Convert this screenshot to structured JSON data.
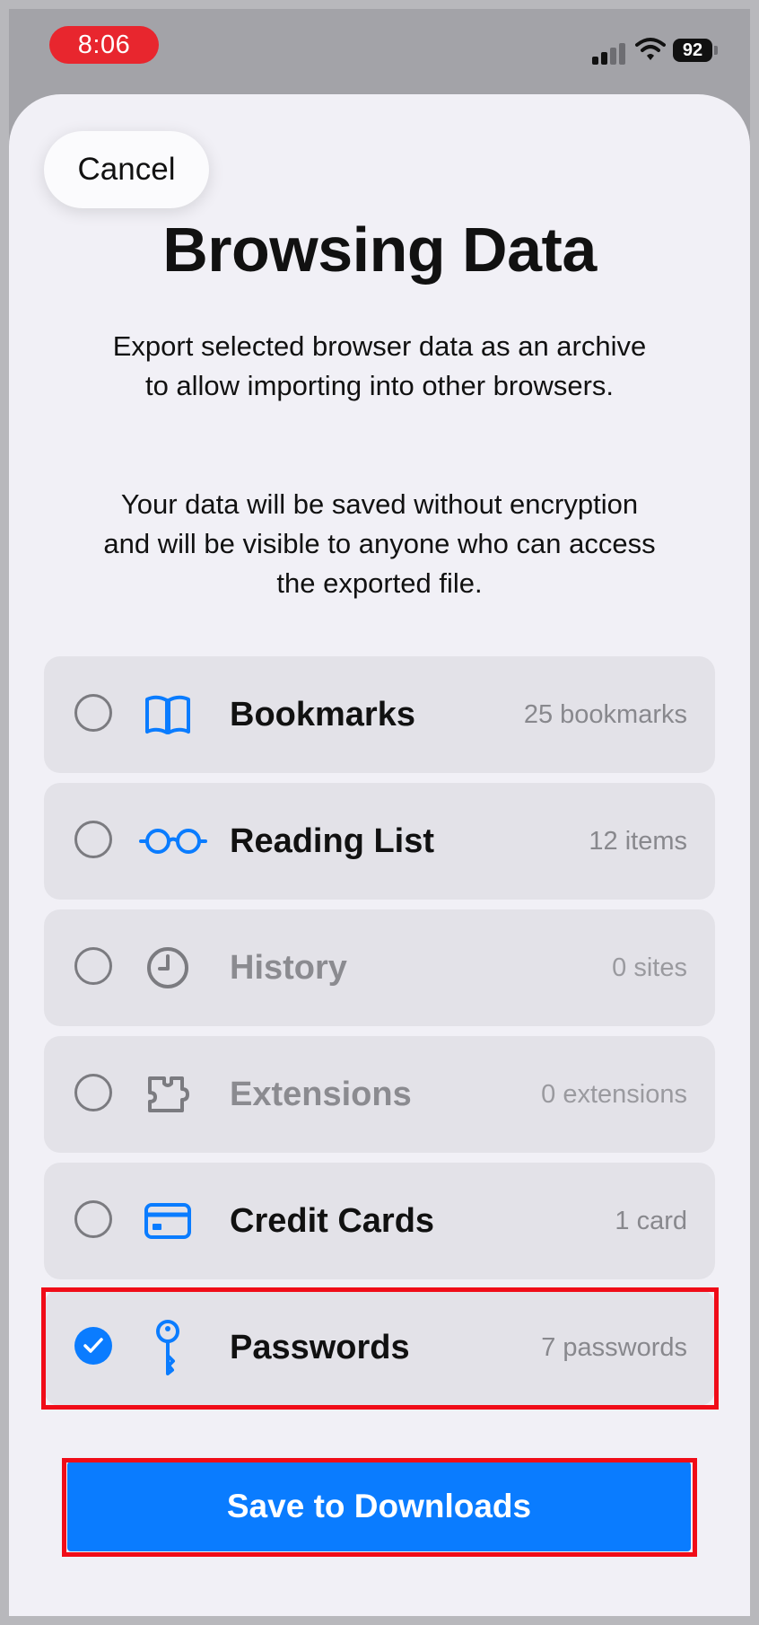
{
  "status_bar": {
    "time": "8:06",
    "battery": "92",
    "time_pill_color": "#e8262e"
  },
  "sheet": {
    "cancel_label": "Cancel",
    "title": "Browsing Data",
    "description_1": "Export selected browser data as an archive to allow importing into other browsers.",
    "description_2": "Your data will be saved without encryption and will be visible to anyone who can access the exported file."
  },
  "items": [
    {
      "label": "Bookmarks",
      "count": "25 bookmarks",
      "icon": "book-icon",
      "checked": false,
      "enabled": true
    },
    {
      "label": "Reading List",
      "count": "12 items",
      "icon": "glasses-icon",
      "checked": false,
      "enabled": true
    },
    {
      "label": "History",
      "count": "0 sites",
      "icon": "clock-icon",
      "checked": false,
      "enabled": false
    },
    {
      "label": "Extensions",
      "count": "0 extensions",
      "icon": "puzzle-icon",
      "checked": false,
      "enabled": false
    },
    {
      "label": "Credit Cards",
      "count": "1 card",
      "icon": "credit-card-icon",
      "checked": false,
      "enabled": true
    },
    {
      "label": "Passwords",
      "count": "7 passwords",
      "icon": "key-icon",
      "checked": true,
      "enabled": true
    }
  ],
  "save_label": "Save to Downloads",
  "colors": {
    "accent": "#0a7cff",
    "highlight": "#f00c18"
  }
}
